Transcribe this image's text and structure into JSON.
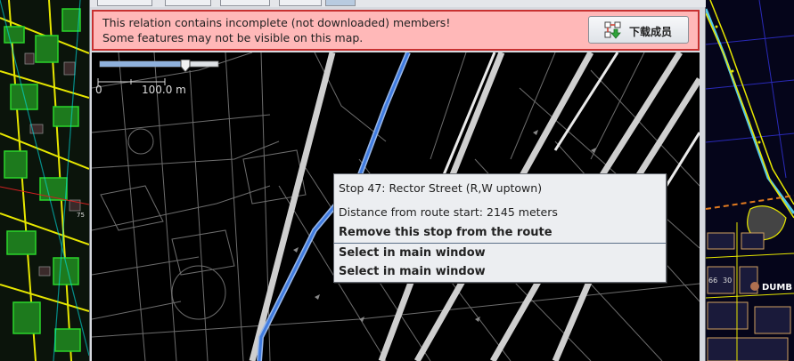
{
  "tabs": [
    {
      "label": ""
    },
    {
      "label": ""
    },
    {
      "label": ""
    },
    {
      "label": ""
    },
    {
      "label": ""
    }
  ],
  "warning": {
    "line1": "This relation contains incomplete (not downloaded) members!",
    "line2": "Some features may not be visible on this map.",
    "button_label": "下载成员",
    "button_icon": "download-members-icon"
  },
  "map": {
    "scale_zero": "0",
    "scale_label": "100.0 m",
    "zoom_level": 0.72
  },
  "context_menu": {
    "title": "Stop 47: Rector Street (R,W uptown)",
    "distance": "Distance from route start: 2145 meters",
    "remove": "Remove this stop from the route",
    "select_1": "Select in main window",
    "select_2": "Select in main window"
  },
  "right_map": {
    "labels": [
      "66",
      "30",
      "DUMB"
    ]
  },
  "left_map": {
    "labels": [
      "75"
    ]
  },
  "colors": {
    "warning_bg": "#ffb8b8",
    "warning_border": "#c83131",
    "route_blue": "#3f7be0",
    "map_bg": "#000000"
  }
}
